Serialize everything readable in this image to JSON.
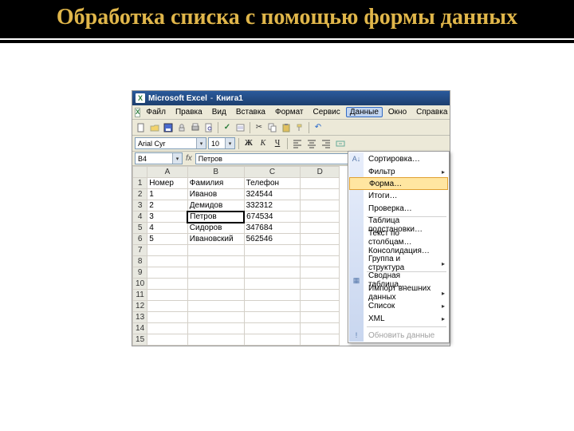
{
  "slide": {
    "title": "Обработка списка с помощью формы данных"
  },
  "titlebar": {
    "app": "Microsoft Excel",
    "doc": "Книга1"
  },
  "menu": {
    "file": "Файл",
    "edit": "Правка",
    "view": "Вид",
    "insert": "Вставка",
    "format": "Формат",
    "tools": "Сервис",
    "data": "Данные",
    "window": "Окно",
    "help": "Справка"
  },
  "format": {
    "font": "Arial Cyr",
    "size": "10",
    "bold": "Ж",
    "italic": "К",
    "underline": "Ч"
  },
  "namebox": "B4",
  "formula": "Петров",
  "columns": [
    "A",
    "B",
    "C",
    "D"
  ],
  "headers": {
    "a": "Номер",
    "b": "Фамилия",
    "c": "Телефон"
  },
  "rows": [
    {
      "n": "1",
      "a": "Номер",
      "b": "Фамилия",
      "c": "Телефон"
    },
    {
      "n": "2",
      "a": "1",
      "b": "Иванов",
      "c": "324544"
    },
    {
      "n": "3",
      "a": "2",
      "b": "Демидов",
      "c": "332312"
    },
    {
      "n": "4",
      "a": "3",
      "b": "Петров",
      "c": "674534"
    },
    {
      "n": "5",
      "a": "4",
      "b": "Сидоров",
      "c": "347684"
    },
    {
      "n": "6",
      "a": "5",
      "b": "Ивановский",
      "c": "562546"
    },
    {
      "n": "7",
      "a": "",
      "b": "",
      "c": ""
    },
    {
      "n": "8",
      "a": "",
      "b": "",
      "c": ""
    },
    {
      "n": "9",
      "a": "",
      "b": "",
      "c": ""
    },
    {
      "n": "10",
      "a": "",
      "b": "",
      "c": ""
    },
    {
      "n": "11",
      "a": "",
      "b": "",
      "c": ""
    },
    {
      "n": "12",
      "a": "",
      "b": "",
      "c": ""
    },
    {
      "n": "13",
      "a": "",
      "b": "",
      "c": ""
    },
    {
      "n": "14",
      "a": "",
      "b": "",
      "c": ""
    },
    {
      "n": "15",
      "a": "",
      "b": "",
      "c": ""
    }
  ],
  "ctx": {
    "sort": "Сортировка…",
    "filter": "Фильтр",
    "form": "Форма…",
    "itogi": "Итоги…",
    "validate": "Проверка…",
    "table": "Таблица подстановки…",
    "textcols": "Текст по столбцам…",
    "consol": "Консолидация…",
    "group": "Группа и структура",
    "pivot": "Сводная таблица…",
    "import": "Импорт внешних данных",
    "list": "Список",
    "xml": "XML",
    "refresh": "Обновить данные"
  }
}
